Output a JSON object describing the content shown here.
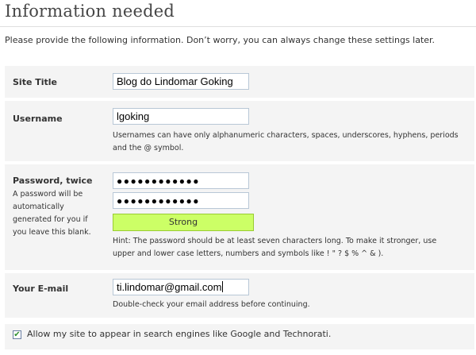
{
  "header": {
    "title": "Information needed",
    "intro": "Please provide the following information. Don’t worry, you can always change these settings later."
  },
  "site_title": {
    "label": "Site Title",
    "value": "Blog do Lindomar Goking"
  },
  "username": {
    "label": "Username",
    "value": "lgoking",
    "hint_line1": "Usernames can have only alphanumeric characters, spaces, underscores, hyphens, periods",
    "hint_line2": "and the @ symbol."
  },
  "password": {
    "label": "Password, twice",
    "sub_line1": "A password will be",
    "sub_line2": "automatically",
    "sub_line3": "generated for you if",
    "sub_line4": "you leave this blank.",
    "value1": "●●●●●●●●●●●●",
    "value2": "●●●●●●●●●●●●",
    "strength": "Strong",
    "hint_line1": "Hint: The password should be at least seven characters long. To make it stronger, use",
    "hint_line2": "upper and lower case letters, numbers and symbols like ! \" ? $ % ^ & )."
  },
  "email": {
    "label": "Your E-mail",
    "value": "ti.lindomar@gmail.com",
    "hint": "Double-check your email address before continuing."
  },
  "privacy": {
    "checked": true,
    "check_glyph": "✔",
    "label": "Allow my site to appear in search engines like Google and Technorati."
  },
  "colors": {
    "row_background": "#f4f4f4",
    "strength_good": "#ccff66",
    "input_border": "#b8c7d6"
  }
}
